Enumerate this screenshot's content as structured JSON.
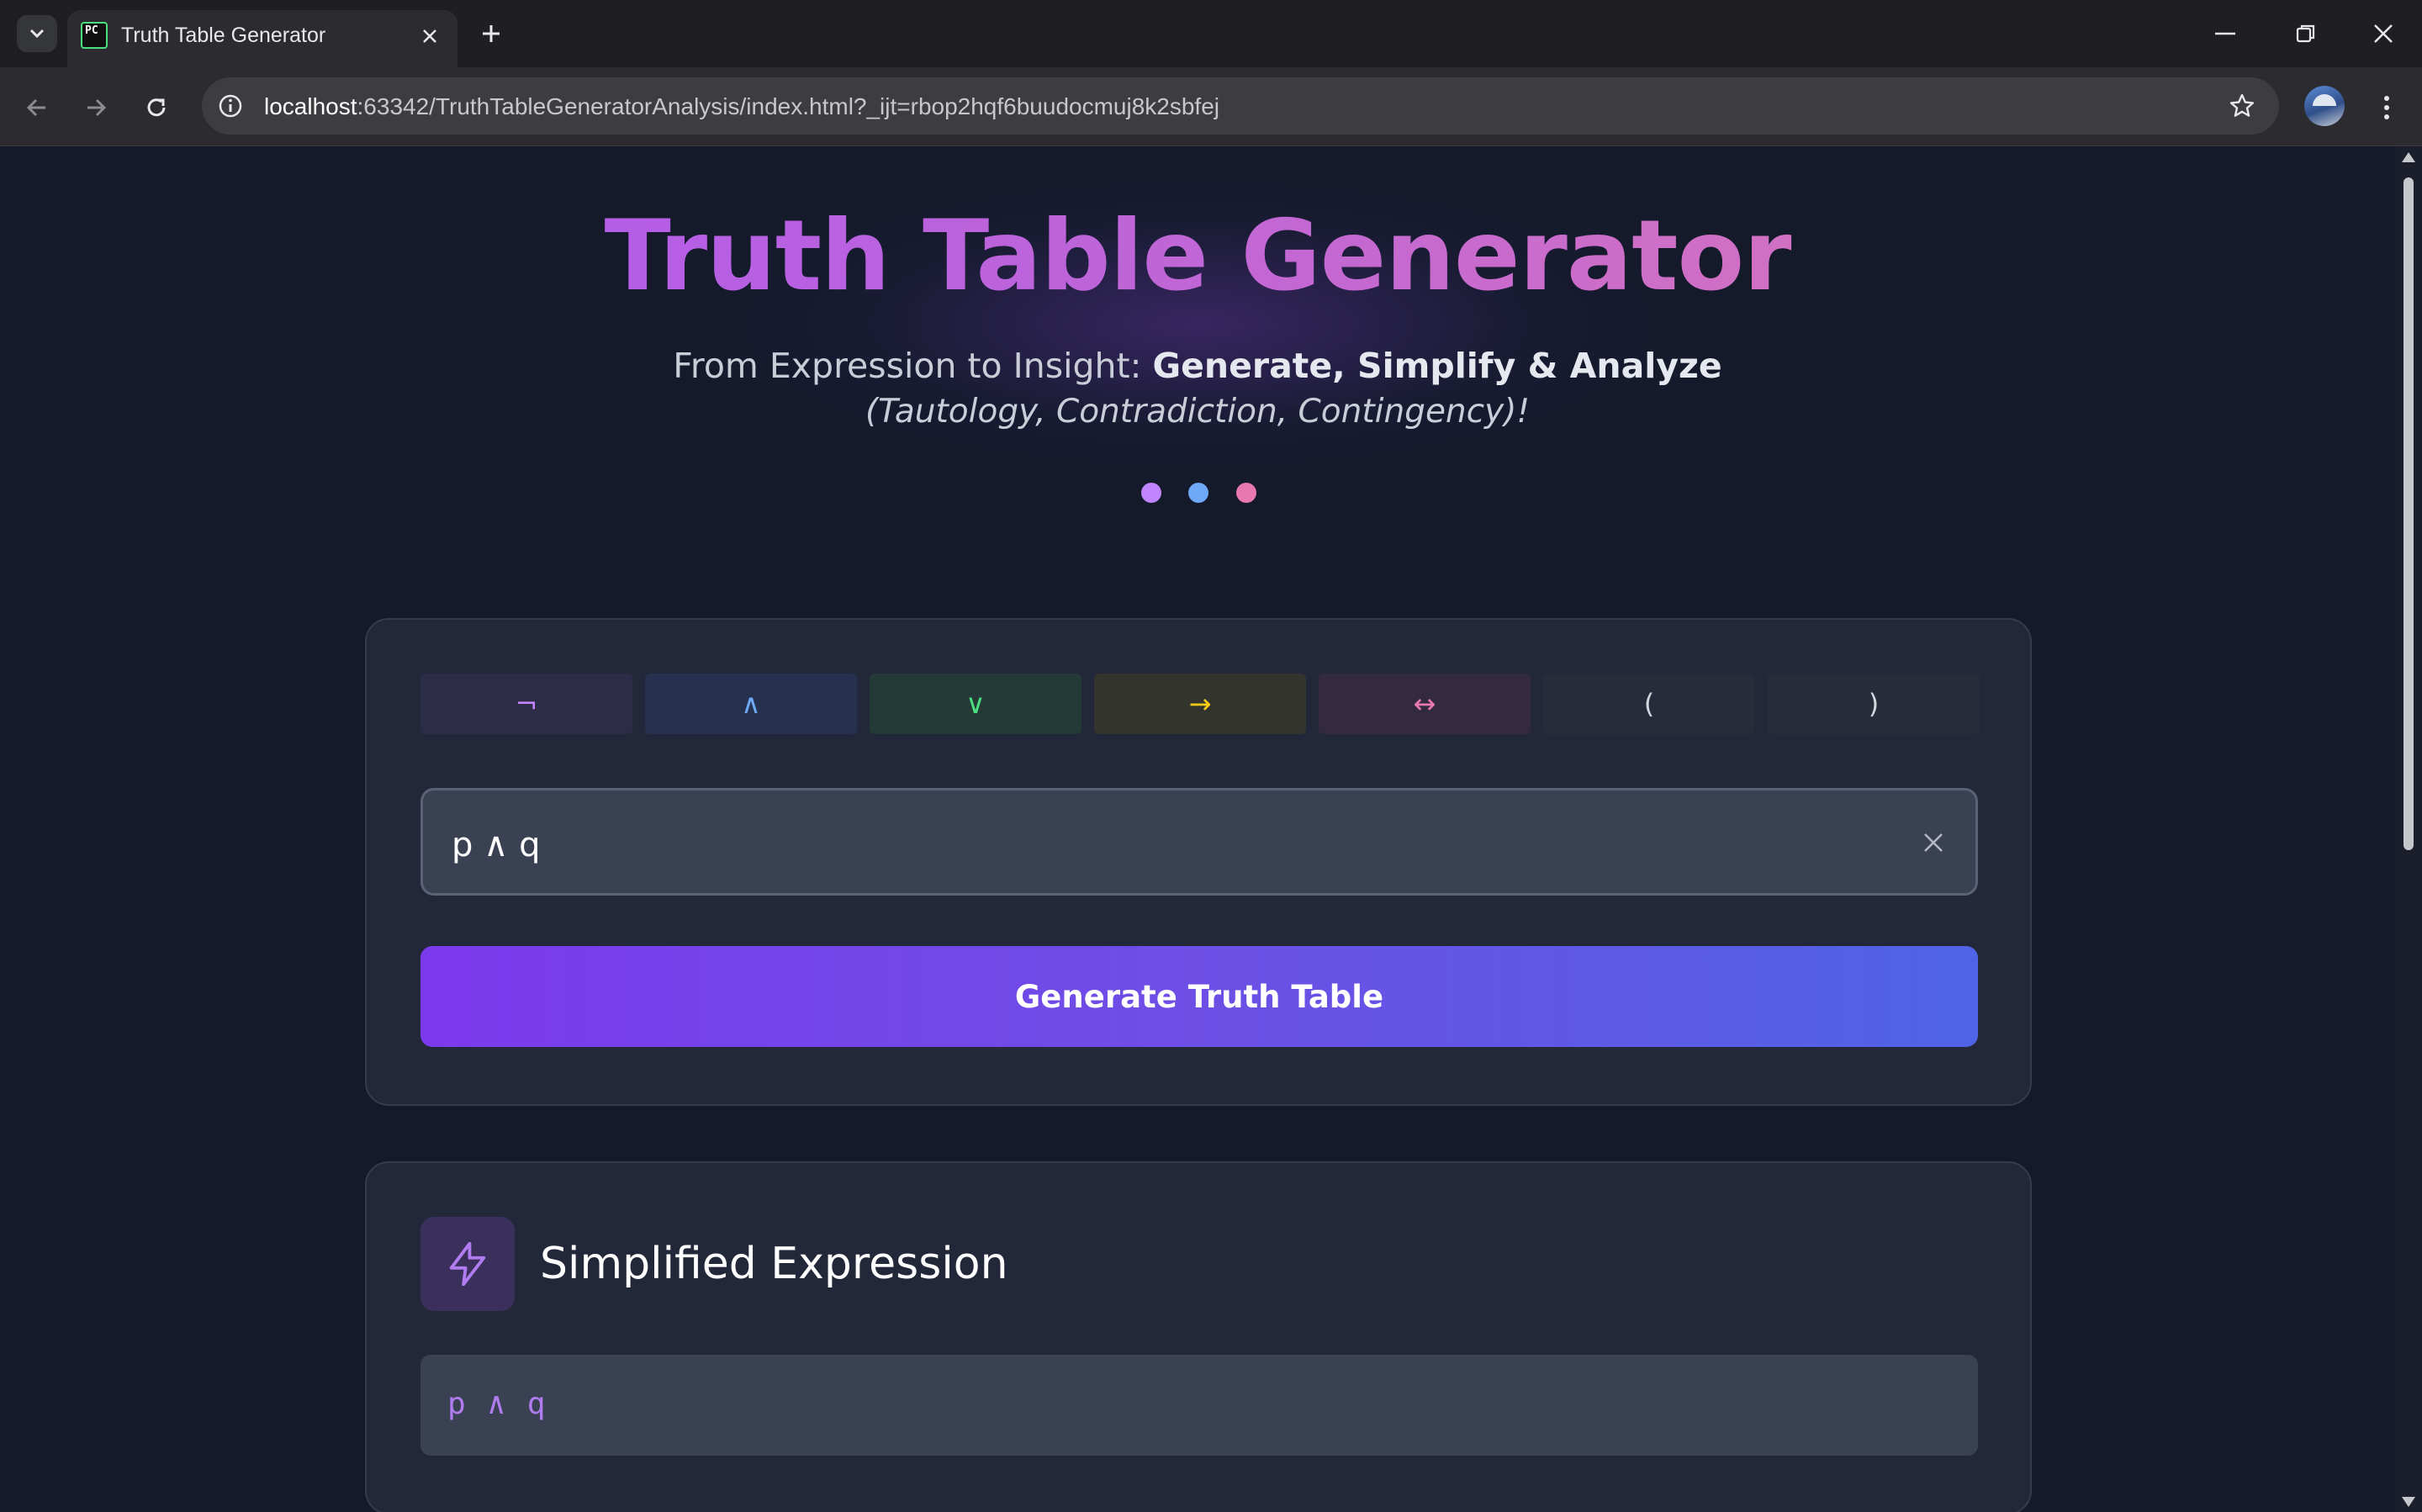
{
  "browser": {
    "tab_title": "Truth Table Generator",
    "favicon_text": "PC",
    "url_host": "localhost",
    "url_rest": ":63342/TruthTableGeneratorAnalysis/index.html?_ijt=rbop2hqf6buudocmuj8k2sbfej"
  },
  "hero": {
    "title": "Truth Table Generator",
    "subtitle_plain": "From Expression to Insight: ",
    "subtitle_bold": "Generate, Simplify & Analyze",
    "subtitle_italic": "(Tautology, Contradiction, Contingency)!",
    "dot_colors": [
      "#c084fc",
      "#6ea8f7",
      "#e879b0"
    ]
  },
  "operators": [
    {
      "symbol": "¬",
      "bg": "#2c2c48",
      "color": "#c084fc"
    },
    {
      "symbol": "∧",
      "bg": "#263150",
      "color": "#6ea8f7"
    },
    {
      "symbol": "∨",
      "bg": "#243a36",
      "color": "#4ade80"
    },
    {
      "symbol": "→",
      "bg": "#33342e",
      "color": "#facc15"
    },
    {
      "symbol": "↔",
      "bg": "#342a40",
      "color": "#e879b0"
    },
    {
      "symbol": "(",
      "bg": "#272c3a",
      "color": "#d4d7de"
    },
    {
      "symbol": ")",
      "bg": "#272c3a",
      "color": "#d4d7de"
    }
  ],
  "expression": {
    "value": "p ∧ q"
  },
  "generate_button": "Generate Truth Table",
  "simplified": {
    "title": "Simplified Expression",
    "value": "p ∧ q"
  },
  "icons": {
    "tab_dropdown": "chevron-down-icon",
    "tab_close": "close-icon",
    "new_tab": "plus-icon",
    "back": "arrow-left-icon",
    "forward": "arrow-right-icon",
    "reload": "reload-icon",
    "site_info": "info-icon",
    "bookmark": "star-icon",
    "menu": "kebab-icon",
    "clear": "close-icon",
    "simplify": "lightning-icon"
  }
}
